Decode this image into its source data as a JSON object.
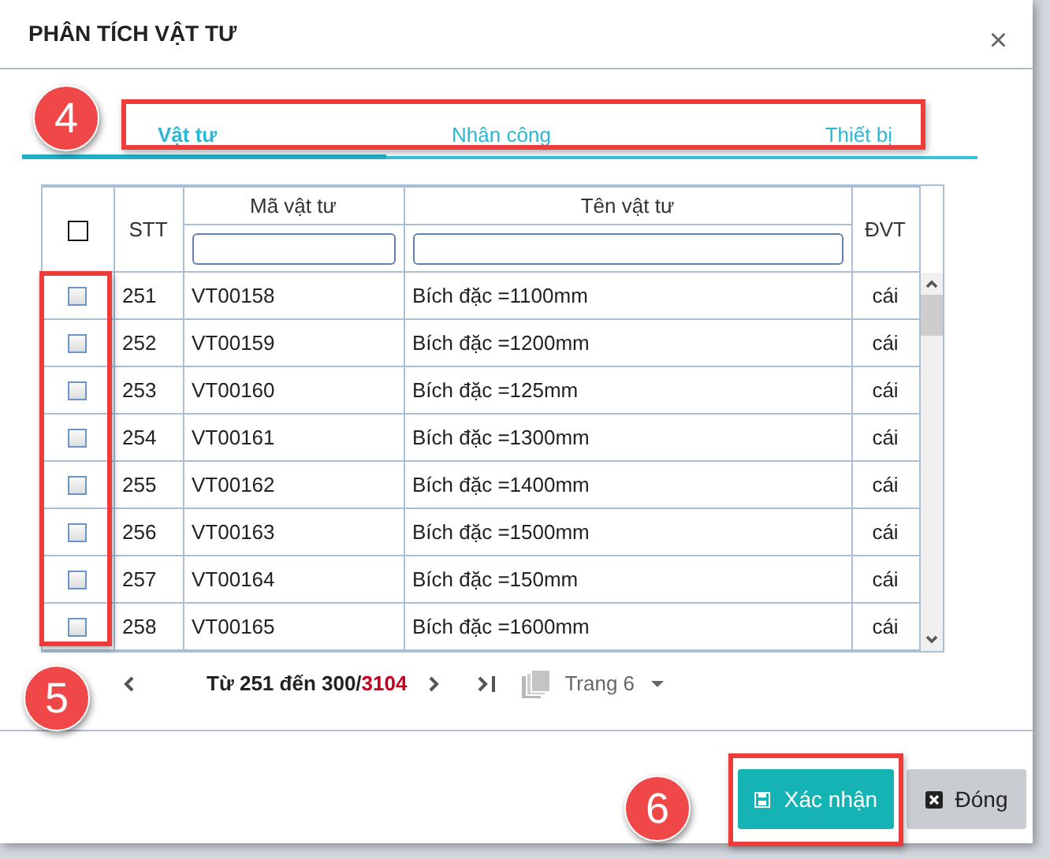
{
  "dialog": {
    "title": "PHÂN TÍCH VẬT TƯ",
    "close": "×"
  },
  "tabs": [
    {
      "label": "Vật tư",
      "selected": true
    },
    {
      "label": "Nhân công",
      "selected": false
    },
    {
      "label": "Thiết bị",
      "selected": false
    }
  ],
  "table": {
    "select_all": {
      "checked": false
    },
    "columns": [
      {
        "label": "STT",
        "filter": false
      },
      {
        "label": "Mã vật tư",
        "filter": true
      },
      {
        "label": "Tên vật tư",
        "filter": true
      },
      {
        "label": "ĐVT",
        "filter": false
      }
    ],
    "rows": [
      {
        "checked": false,
        "stt": "251",
        "code": "VT00158",
        "name": "Bích đặc =1100mm",
        "unit": "cái"
      },
      {
        "checked": false,
        "stt": "252",
        "code": "VT00159",
        "name": "Bích đặc =1200mm",
        "unit": "cái"
      },
      {
        "checked": false,
        "stt": "253",
        "code": "VT00160",
        "name": "Bích đặc =125mm",
        "unit": "cái"
      },
      {
        "checked": false,
        "stt": "254",
        "code": "VT00161",
        "name": "Bích đặc =1300mm",
        "unit": "cái"
      },
      {
        "checked": false,
        "stt": "255",
        "code": "VT00162",
        "name": "Bích đặc =1400mm",
        "unit": "cái"
      },
      {
        "checked": false,
        "stt": "256",
        "code": "VT00163",
        "name": "Bích đặc =1500mm",
        "unit": "cái"
      },
      {
        "checked": false,
        "stt": "257",
        "code": "VT00164",
        "name": "Bích đặc =150mm",
        "unit": "cái"
      },
      {
        "checked": false,
        "stt": "258",
        "code": "VT00165",
        "name": "Bích đặc =1600mm",
        "unit": "cái"
      }
    ]
  },
  "pagination": {
    "range": "Từ 251 đến 300/",
    "total": "3104",
    "page": "Trang 6"
  },
  "buttons": [
    {
      "label": "Xác nhận",
      "kind": "primary"
    },
    {
      "label": "Đóng",
      "kind": "secondary"
    }
  ],
  "callouts": [
    {
      "number": "4"
    },
    {
      "number": "5"
    },
    {
      "number": "6"
    }
  ]
}
